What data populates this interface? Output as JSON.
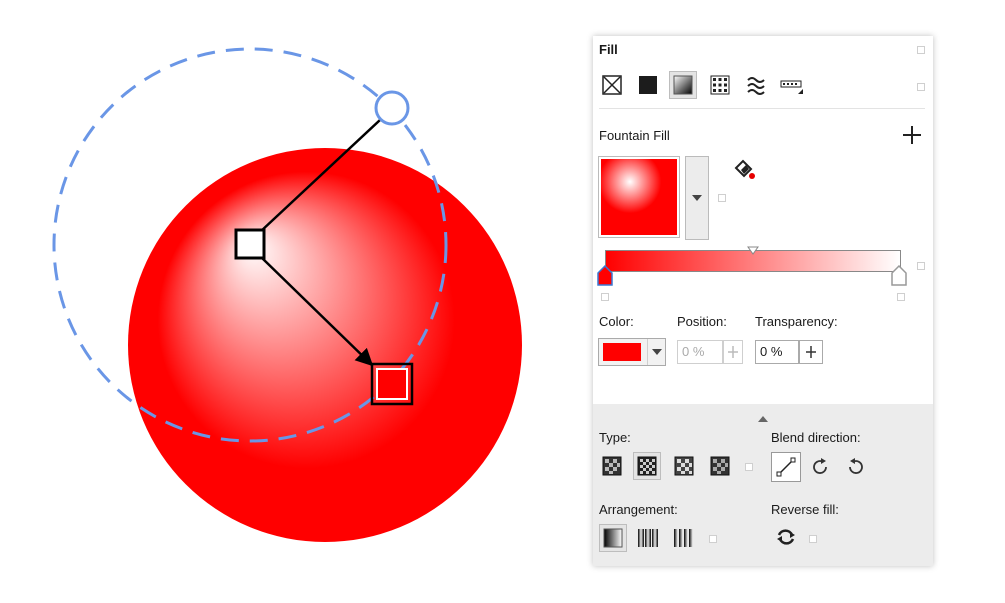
{
  "colors": {
    "fill_red": "#ff0000",
    "highlight": "#ffffff",
    "guide_circle": "#6a96e6",
    "panel_bg": "#ffffff",
    "panel_lower_bg": "#ececec"
  },
  "canvas": {
    "object": "sphere with radial fountain fill",
    "handles": [
      "center-handle",
      "end-handle",
      "angle-handle"
    ]
  },
  "panel": {
    "title": "Fill",
    "fill_types": [
      {
        "name": "no-fill-icon",
        "selected": false
      },
      {
        "name": "uniform-fill-icon",
        "selected": false
      },
      {
        "name": "fountain-fill-icon",
        "selected": true
      },
      {
        "name": "vector-pattern-fill-icon",
        "selected": false
      },
      {
        "name": "bitmap-pattern-fill-icon",
        "selected": false
      },
      {
        "name": "postscript-fill-icon",
        "selected": false
      }
    ],
    "fountain": {
      "label": "Fountain Fill",
      "add_icon": "plus-icon",
      "color_label": "Color:",
      "position_label": "Position:",
      "position_value": "0 %",
      "transparency_label": "Transparency:",
      "transparency_value": "0 %",
      "selected_node_color": "#ff0000"
    },
    "type_section": {
      "type_label": "Type:",
      "type_buttons": [
        "linear-type-icon",
        "elliptical-type-icon",
        "conical-type-icon",
        "rectangular-type-icon"
      ],
      "blend_label": "Blend direction:",
      "blend_buttons": [
        "line-blend-icon",
        "clockwise-blend-icon",
        "counterclockwise-blend-icon"
      ],
      "arrangement_label": "Arrangement:",
      "arrangement_buttons": [
        "default-arrangement-icon",
        "mirror-arrangement-icon",
        "repeat-arrangement-icon"
      ],
      "reverse_label": "Reverse fill:"
    }
  }
}
